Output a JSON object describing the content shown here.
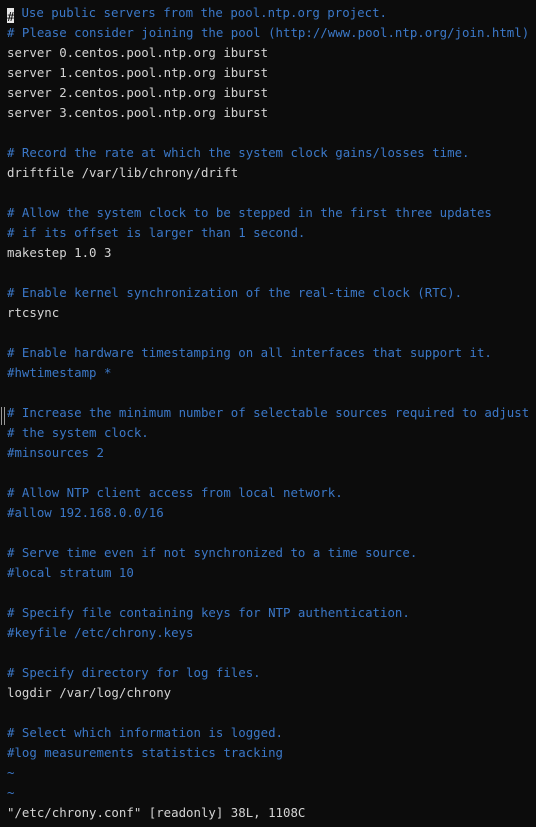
{
  "editor": {
    "cursor_char": "#",
    "lines": [
      {
        "text": " Use public servers from the pool.ntp.org project.",
        "type": "comment",
        "cursor": true
      },
      {
        "text": "# Please consider joining the pool (http://www.pool.ntp.org/join.html).",
        "type": "comment"
      },
      {
        "text": "server 0.centos.pool.ntp.org iburst",
        "type": "code"
      },
      {
        "text": "server 1.centos.pool.ntp.org iburst",
        "type": "code"
      },
      {
        "text": "server 2.centos.pool.ntp.org iburst",
        "type": "code"
      },
      {
        "text": "server 3.centos.pool.ntp.org iburst",
        "type": "code"
      },
      {
        "text": "",
        "type": "blank"
      },
      {
        "text": "# Record the rate at which the system clock gains/losses time.",
        "type": "comment"
      },
      {
        "text": "driftfile /var/lib/chrony/drift",
        "type": "code"
      },
      {
        "text": "",
        "type": "blank"
      },
      {
        "text": "# Allow the system clock to be stepped in the first three updates",
        "type": "comment"
      },
      {
        "text": "# if its offset is larger than 1 second.",
        "type": "comment"
      },
      {
        "text": "makestep 1.0 3",
        "type": "code"
      },
      {
        "text": "",
        "type": "blank"
      },
      {
        "text": "# Enable kernel synchronization of the real-time clock (RTC).",
        "type": "comment"
      },
      {
        "text": "rtcsync",
        "type": "code"
      },
      {
        "text": "",
        "type": "blank"
      },
      {
        "text": "# Enable hardware timestamping on all interfaces that support it.",
        "type": "comment"
      },
      {
        "text": "#hwtimestamp *",
        "type": "comment"
      },
      {
        "text": "",
        "type": "blank"
      },
      {
        "text": "# Increase the minimum number of selectable sources required to adjust",
        "type": "comment"
      },
      {
        "text": "# the system clock.",
        "type": "comment"
      },
      {
        "text": "#minsources 2",
        "type": "comment"
      },
      {
        "text": "",
        "type": "blank"
      },
      {
        "text": "# Allow NTP client access from local network.",
        "type": "comment"
      },
      {
        "text": "#allow 192.168.0.0/16",
        "type": "comment"
      },
      {
        "text": "",
        "type": "blank"
      },
      {
        "text": "# Serve time even if not synchronized to a time source.",
        "type": "comment"
      },
      {
        "text": "#local stratum 10",
        "type": "comment"
      },
      {
        "text": "",
        "type": "blank"
      },
      {
        "text": "# Specify file containing keys for NTP authentication.",
        "type": "comment"
      },
      {
        "text": "#keyfile /etc/chrony.keys",
        "type": "comment"
      },
      {
        "text": "",
        "type": "blank"
      },
      {
        "text": "# Specify directory for log files.",
        "type": "comment"
      },
      {
        "text": "logdir /var/log/chrony",
        "type": "code"
      },
      {
        "text": "",
        "type": "blank"
      },
      {
        "text": "# Select which information is logged.",
        "type": "comment"
      },
      {
        "text": "#log measurements statistics tracking",
        "type": "comment"
      },
      {
        "text": "~",
        "type": "tilde"
      },
      {
        "text": "~",
        "type": "tilde"
      }
    ]
  },
  "status_line": "\"/etc/chrony.conf\" [readonly] 38L, 1108C",
  "colors": {
    "background": "#0c0c0c",
    "comment": "#3b78c8",
    "code": "#d4d4d4",
    "cursor": "#e6e6e6"
  }
}
